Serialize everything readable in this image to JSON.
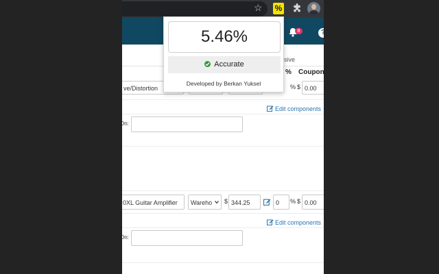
{
  "popup": {
    "value": "5.46%",
    "status": "Accurate",
    "developer": "Developed by Berkan Yuksel"
  },
  "navbar": {
    "notification_count": "8",
    "help_icon": "?"
  },
  "browser": {
    "extension_label": "%"
  },
  "table": {
    "tab_label": "sive",
    "col_percent": "%",
    "col_coupon": "Coupon",
    "edit_components": "Edit components",
    "on_label": "On:",
    "rows": [
      {
        "product": "ve/Distortion",
        "percent_sign": "%",
        "coupon_currency": "$",
        "coupon_value": "0.00"
      },
      {
        "product": "0XL Guitar Amplifier",
        "warehouse": "Wareho",
        "price_currency": "$",
        "price": "344.25",
        "percent": "0",
        "percent_sign": "%",
        "coupon_currency": "$",
        "coupon_value": "0.00"
      }
    ]
  },
  "colors": {
    "navbar": "#114861",
    "badge": "#e8336d",
    "extension": "#f5e400",
    "success": "#2e9d3a",
    "link": "#2a76b0"
  }
}
